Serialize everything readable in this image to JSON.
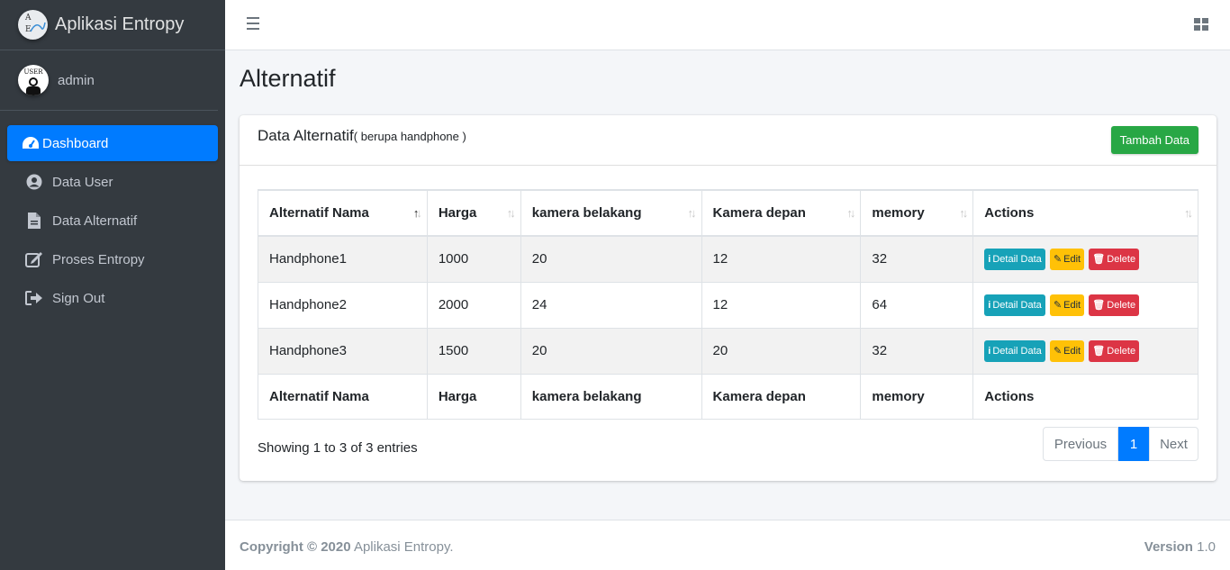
{
  "brand": {
    "title": "Aplikasi Entropy",
    "logo_letters": [
      "A",
      "E"
    ]
  },
  "user": {
    "avatar_text": "USER",
    "name": "admin"
  },
  "sidebar": {
    "items": [
      {
        "label": "Dashboard",
        "icon": "tachometer-icon",
        "active": true
      },
      {
        "label": "Data User",
        "icon": "user-circle-icon"
      },
      {
        "label": "Data Alternatif",
        "icon": "file-icon"
      },
      {
        "label": "Proses Entropy",
        "icon": "edit-icon"
      },
      {
        "label": "Sign Out",
        "icon": "sign-out-icon"
      }
    ]
  },
  "page": {
    "title": "Alternatif"
  },
  "card": {
    "title": "Data Alternatif",
    "subtitle": "( berupa handphone )",
    "add_button": "Tambah Data"
  },
  "table": {
    "columns": [
      "Alternatif Nama",
      "Harga",
      "kamera belakang",
      "Kamera depan",
      "memory",
      "Actions"
    ],
    "rows": [
      {
        "nama": "Handphone1",
        "harga": "1000",
        "kamera_belakang": "20",
        "kamera_depan": "12",
        "memory": "32"
      },
      {
        "nama": "Handphone2",
        "harga": "2000",
        "kamera_belakang": "24",
        "kamera_depan": "12",
        "memory": "64"
      },
      {
        "nama": "Handphone3",
        "harga": "1500",
        "kamera_belakang": "20",
        "kamera_depan": "20",
        "memory": "32"
      }
    ],
    "actions": {
      "detail": "Detail Data",
      "edit": "Edit",
      "delete": "Delete"
    }
  },
  "pagination": {
    "info": "Showing 1 to 3 of 3 entries",
    "previous": "Previous",
    "current": "1",
    "next": "Next"
  },
  "footer": {
    "copyright": "Copyright © 2020",
    "app": "Aplikasi Entropy.",
    "version_label": "Version",
    "version": "1.0"
  },
  "colors": {
    "sidebar_bg": "#343a40",
    "primary": "#007bff",
    "success": "#28a745",
    "info": "#17a2b8",
    "warning": "#ffc107",
    "danger": "#dc3545"
  }
}
